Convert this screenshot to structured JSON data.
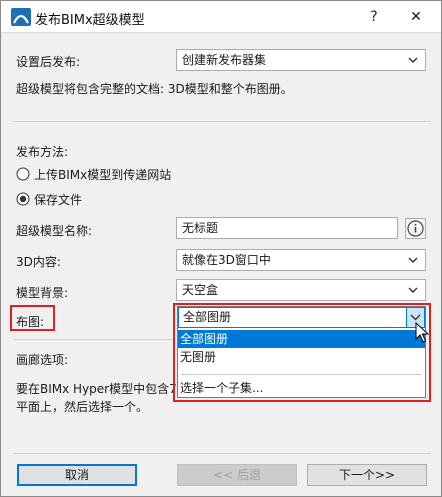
{
  "window": {
    "title": "发布BIMx超级模型",
    "help_label": "?",
    "close_label": "✕"
  },
  "colors": {
    "accent": "#0078d7",
    "highlight_box": "#e02020",
    "selected_bg": "#0078d7"
  },
  "settings": {
    "after_publish_label": "设置后发布:",
    "after_publish_value": "创建新发布器集",
    "description": "超级模型将包含完整的文档: 3D模型和整个布图册。"
  },
  "publish_method": {
    "label": "发布方法:",
    "options": [
      {
        "label": "上传BIMx模型到传递网站",
        "checked": false
      },
      {
        "label": "保存文件",
        "checked": true
      }
    ]
  },
  "form": {
    "name_label": "超级模型名称:",
    "name_value": "无标题",
    "content_label": "3D内容:",
    "content_value": "就像在3D窗口中",
    "background_label": "模型背景:",
    "background_value": "天空盒",
    "layout_label": "布图:",
    "gallery_label": "画廊选项:",
    "hyper_note_line1": "要在BIMx Hyper模型中包含7",
    "hyper_note_line2": "平面上，然后选择一个。"
  },
  "layout_dropdown": {
    "selected_value": "全部图册",
    "items": [
      {
        "label": "全部图册",
        "selected": true
      },
      {
        "label": "无图册",
        "selected": false
      },
      {
        "label": "选择一个子集...",
        "selected": false
      }
    ]
  },
  "footer": {
    "cancel_label": "取消",
    "back_label": "<< 后退",
    "next_label": "下一个>>"
  },
  "icons": {
    "app": "archicad-app-icon",
    "info": "info-icon",
    "chevron": "chevron-down-icon",
    "cursor": "mouse-pointer-icon"
  }
}
